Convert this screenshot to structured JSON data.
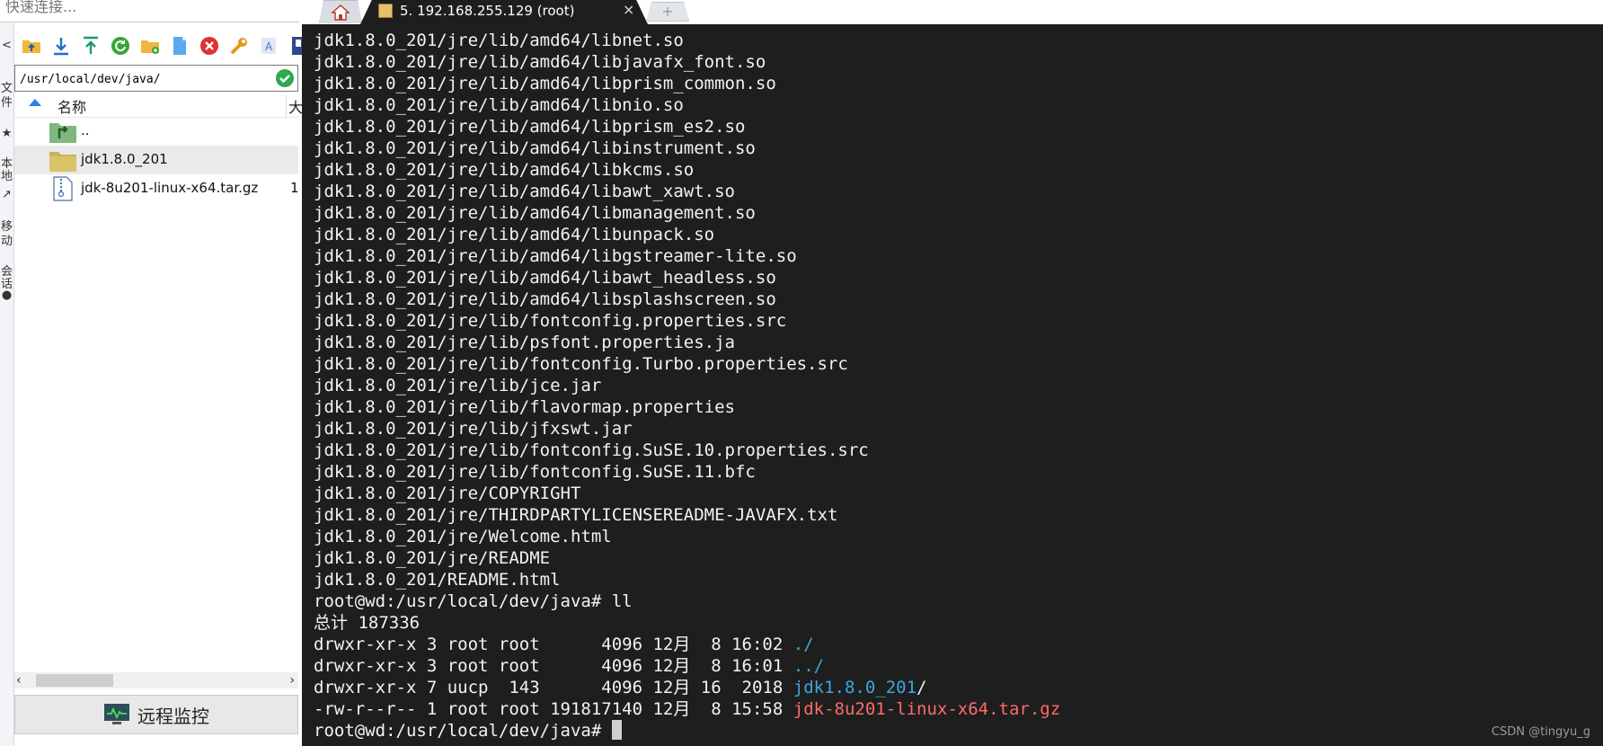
{
  "quick_connect": {
    "placeholder": "快速连接..."
  },
  "left_strip": {
    "glyphs": [
      "<",
      "文",
      "件",
      "★",
      "本",
      "地",
      "↗",
      "移",
      "动",
      "会",
      "话",
      "●"
    ]
  },
  "file_panel": {
    "toolbar_icons": [
      "folder-up-icon",
      "download-icon",
      "upload-icon",
      "refresh-icon",
      "new-folder-icon",
      "new-file-icon",
      "delete-icon",
      "wrench-icon",
      "rename-icon",
      "bookmark-icon"
    ],
    "path": "/usr/local/dev/java/",
    "columns": {
      "name": "名称",
      "size": "大"
    },
    "files": [
      {
        "name": "..",
        "size": "",
        "icon": "parent-dir-icon",
        "selected": false
      },
      {
        "name": "jdk1.8.0_201",
        "size": "",
        "icon": "folder-icon",
        "selected": true
      },
      {
        "name": "jdk-8u201-linux-x64.tar.gz",
        "size": "1",
        "icon": "archive-file-icon",
        "selected": false
      }
    ],
    "monitor_label": "远程监控"
  },
  "tabs": {
    "home_icon": "home-icon",
    "active_title": "5. 192.168.255.129 (root)",
    "close_glyph": "×",
    "new_tab_glyph": "+"
  },
  "terminal": {
    "colors": {
      "background": "#1e1e1e",
      "text": "#f2f2f2",
      "directory": "#3ea6dd",
      "archive": "#ff6b6b"
    },
    "lines": [
      [
        {
          "t": "jdk1.8.0_201/jre/lib/amd64/libnet.so"
        }
      ],
      [
        {
          "t": "jdk1.8.0_201/jre/lib/amd64/libjavafx_font.so"
        }
      ],
      [
        {
          "t": "jdk1.8.0_201/jre/lib/amd64/libprism_common.so"
        }
      ],
      [
        {
          "t": "jdk1.8.0_201/jre/lib/amd64/libnio.so"
        }
      ],
      [
        {
          "t": "jdk1.8.0_201/jre/lib/amd64/libprism_es2.so"
        }
      ],
      [
        {
          "t": "jdk1.8.0_201/jre/lib/amd64/libinstrument.so"
        }
      ],
      [
        {
          "t": "jdk1.8.0_201/jre/lib/amd64/libkcms.so"
        }
      ],
      [
        {
          "t": "jdk1.8.0_201/jre/lib/amd64/libawt_xawt.so"
        }
      ],
      [
        {
          "t": "jdk1.8.0_201/jre/lib/amd64/libmanagement.so"
        }
      ],
      [
        {
          "t": "jdk1.8.0_201/jre/lib/amd64/libunpack.so"
        }
      ],
      [
        {
          "t": "jdk1.8.0_201/jre/lib/amd64/libgstreamer-lite.so"
        }
      ],
      [
        {
          "t": "jdk1.8.0_201/jre/lib/amd64/libawt_headless.so"
        }
      ],
      [
        {
          "t": "jdk1.8.0_201/jre/lib/amd64/libsplashscreen.so"
        }
      ],
      [
        {
          "t": "jdk1.8.0_201/jre/lib/fontconfig.properties.src"
        }
      ],
      [
        {
          "t": "jdk1.8.0_201/jre/lib/psfont.properties.ja"
        }
      ],
      [
        {
          "t": "jdk1.8.0_201/jre/lib/fontconfig.Turbo.properties.src"
        }
      ],
      [
        {
          "t": "jdk1.8.0_201/jre/lib/jce.jar"
        }
      ],
      [
        {
          "t": "jdk1.8.0_201/jre/lib/flavormap.properties"
        }
      ],
      [
        {
          "t": "jdk1.8.0_201/jre/lib/jfxswt.jar"
        }
      ],
      [
        {
          "t": "jdk1.8.0_201/jre/lib/fontconfig.SuSE.10.properties.src"
        }
      ],
      [
        {
          "t": "jdk1.8.0_201/jre/lib/fontconfig.SuSE.11.bfc"
        }
      ],
      [
        {
          "t": "jdk1.8.0_201/jre/COPYRIGHT"
        }
      ],
      [
        {
          "t": "jdk1.8.0_201/jre/THIRDPARTYLICENSEREADME-JAVAFX.txt"
        }
      ],
      [
        {
          "t": "jdk1.8.0_201/jre/Welcome.html"
        }
      ],
      [
        {
          "t": "jdk1.8.0_201/jre/README"
        }
      ],
      [
        {
          "t": "jdk1.8.0_201/README.html"
        }
      ],
      [
        {
          "t": "root@wd:/usr/local/dev/java# ll"
        }
      ],
      [
        {
          "t": "总计 187336"
        }
      ],
      [
        {
          "t": "drwxr-xr-x 3 root root      4096 12月  8 16:02 "
        },
        {
          "t": "./",
          "c": "dir"
        }
      ],
      [
        {
          "t": "drwxr-xr-x 3 root root      4096 12月  8 16:01 "
        },
        {
          "t": "../",
          "c": "dir"
        }
      ],
      [
        {
          "t": "drwxr-xr-x 7 uucp  143      4096 12月 16  2018 "
        },
        {
          "t": "jdk1.8.0_201",
          "c": "dir"
        },
        {
          "t": "/"
        }
      ],
      [
        {
          "t": "-rw-r--r-- 1 root root 191817140 12月  8 15:58 "
        },
        {
          "t": "jdk-8u201-linux-x64.tar.gz",
          "c": "archive"
        }
      ],
      [
        {
          "t": "root@wd:/usr/local/dev/java# "
        },
        {
          "t": "",
          "c": "cursor"
        }
      ]
    ]
  },
  "watermark": "CSDN @tingyu_g"
}
